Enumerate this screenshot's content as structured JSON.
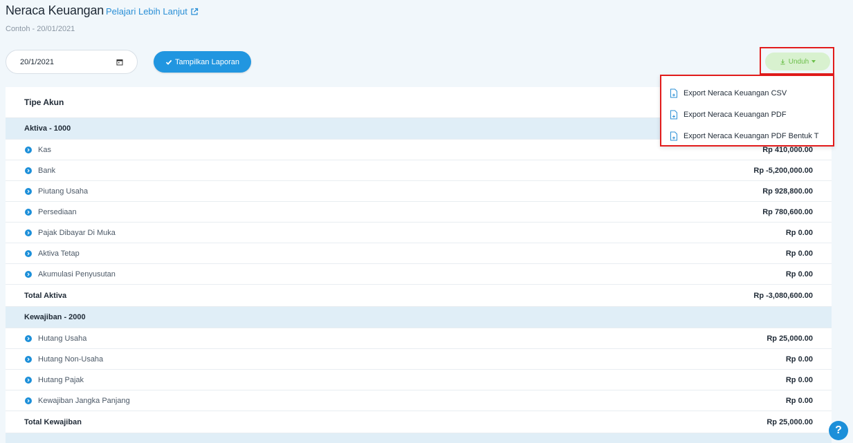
{
  "header": {
    "title": "Neraca Keuangan",
    "learn_more": "Pelajari Lebih Lanjut",
    "subtitle": "Contoh - 20/01/2021"
  },
  "filters": {
    "date_value": "20/1/2021",
    "show_report_label": "Tampilkan Laporan",
    "download_label": "Unduh"
  },
  "download_menu": [
    {
      "label": "Export Neraca Keuangan CSV",
      "icon": "file-export-icon"
    },
    {
      "label": "Export Neraca Keuangan PDF",
      "icon": "file-export-icon"
    },
    {
      "label": "Export Neraca Keuangan PDF Bentuk T",
      "icon": "file-export-icon"
    }
  ],
  "table": {
    "column_header": "Tipe Akun",
    "sections": [
      {
        "title": "Aktiva - 1000",
        "rows": [
          {
            "name": "Kas",
            "amount": "Rp 410,000.00"
          },
          {
            "name": "Bank",
            "amount": "Rp -5,200,000.00"
          },
          {
            "name": "Piutang Usaha",
            "amount": "Rp 928,800.00"
          },
          {
            "name": "Persediaan",
            "amount": "Rp 780,600.00"
          },
          {
            "name": "Pajak Dibayar Di Muka",
            "amount": "Rp 0.00"
          },
          {
            "name": "Aktiva Tetap",
            "amount": "Rp 0.00"
          },
          {
            "name": "Akumulasi Penyusutan",
            "amount": "Rp 0.00"
          }
        ],
        "total_label": "Total Aktiva",
        "total_amount": "Rp -3,080,600.00"
      },
      {
        "title": "Kewajiban - 2000",
        "rows": [
          {
            "name": "Hutang Usaha",
            "amount": "Rp 25,000.00"
          },
          {
            "name": "Hutang Non-Usaha",
            "amount": "Rp 0.00"
          },
          {
            "name": "Hutang Pajak",
            "amount": "Rp 0.00"
          },
          {
            "name": "Kewajiban Jangka Panjang",
            "amount": "Rp 0.00"
          }
        ],
        "total_label": "Total Kewajiban",
        "total_amount": "Rp 25,000.00"
      }
    ]
  },
  "help_label": "?",
  "colors": {
    "accent": "#2196e0",
    "download_bg": "#d8f1cf",
    "download_text": "#6cbf4a",
    "highlight_border": "#e21b1b",
    "section_bg": "#e0eef7"
  }
}
